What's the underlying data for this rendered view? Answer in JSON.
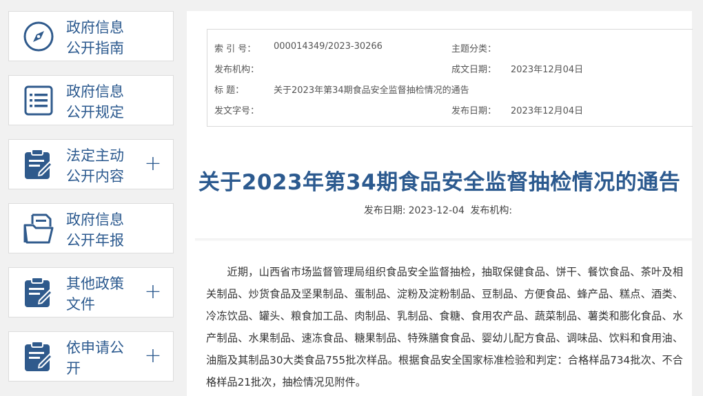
{
  "sidebar": {
    "items": [
      {
        "line1": "政府信息",
        "line2": "公开指南",
        "icon": "compass-icon",
        "has_plus": false
      },
      {
        "line1": "政府信息",
        "line2": "公开规定",
        "icon": "list-document-icon",
        "has_plus": false
      },
      {
        "line1": "法定主动",
        "line2": "公开内容",
        "icon": "clipboard-edit-icon",
        "has_plus": true
      },
      {
        "line1": "政府信息",
        "line2": "公开年报",
        "icon": "open-folder-icon",
        "has_plus": false
      },
      {
        "line1": "其他政策",
        "line2": "文件",
        "icon": "clipboard-edit-icon",
        "has_plus": true
      },
      {
        "line1": "依申请公",
        "line2": "开",
        "icon": "clipboard-edit-icon",
        "has_plus": true
      }
    ],
    "plus_symbol": "+"
  },
  "meta": {
    "index_label": "索  引  号：",
    "index_value": "000014349/2023-30266",
    "topic_label": "主题分类：",
    "topic_value": "",
    "issuer_label": "发布机构：",
    "issuer_value": "",
    "created_label": "成文日期：",
    "created_value": "2023年12月04日",
    "title_label": "标      题：",
    "title_value": "关于2023年第34期食品安全监督抽检情况的通告",
    "docno_label": "发文字号：",
    "docno_value": "",
    "published_label": "发布日期：",
    "published_value": "2023年12月04日"
  },
  "article": {
    "title": "关于2023年第34期食品安全监督抽检情况的通告",
    "pub_date_label": "发布日期:",
    "pub_date_value": "2023-12-04",
    "pub_org_label": "发布机构:",
    "pub_org_value": "",
    "body": "近期，山西省市场监督管理局组织食品安全监督抽检，抽取保健食品、饼干、餐饮食品、茶叶及相关制品、炒货食品及坚果制品、蛋制品、淀粉及淀粉制品、豆制品、方便食品、蜂产品、糕点、酒类、冷冻饮品、罐头、粮食加工品、肉制品、乳制品、食糖、食用农产品、蔬菜制品、薯类和膨化食品、水产制品、水果制品、速冻食品、糖果制品、特殊膳食食品、婴幼儿配方食品、调味品、饮料和食用油、油脂及其制品30大类食品755批次样品。根据食品安全国家标准检验和判定：合格样品734批次、不合格样品21批次，抽检情况见附件。"
  },
  "colors": {
    "accent": "#2c5a8f",
    "icon_fill": "#2f5a8c"
  }
}
